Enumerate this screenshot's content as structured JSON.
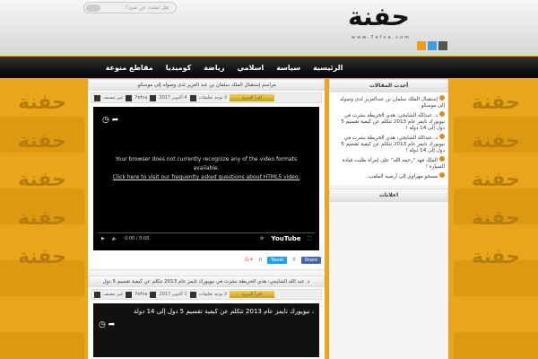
{
  "header": {
    "search_placeholder": "هل تبحث عن شئ؟",
    "logo_text": "حفنة",
    "logo_url": "www.7efna.com"
  },
  "socials": [
    {
      "name": "rss",
      "color": "#f39c12"
    },
    {
      "name": "twitter",
      "color": "#3aa0e8"
    },
    {
      "name": "user",
      "color": "#555555"
    }
  ],
  "nav": [
    "الرئيسية",
    "سياسة",
    "اسلامي",
    "رياضة",
    "كوميديا",
    "مقاطع منوعة"
  ],
  "posts": [
    {
      "title": "مراسم إستقبال الملك سلمان بن عبد العزيز لدى وصوله إلى موسكو.",
      "category": "غير مصنف",
      "author": "7efna",
      "date": "4 أكتوبر 2017",
      "comments": "لا توجد تعليقات",
      "read_more": "اقرأ المزيد",
      "video": {
        "message": "Your browser does not currently recognize any of the video formats available.",
        "link": "Click here to visit our frequently asked questions about HTML5 video.",
        "time": "0:00 / 0:00",
        "brand": "YouTube"
      },
      "share": {
        "facebook": "Share",
        "facebook_count": "0",
        "twitter": "Tweet",
        "twitter_count": "0",
        "gplus": "G+"
      }
    },
    {
      "title": "د. عبد الله الشايجي: هذي الخريطة نشرت في نيويورك تايمز عام 2013 تتكلم عن كيفية تقسيم 5 دول",
      "category": "غير مصنف",
      "author": "7efna",
      "date": "1 أكتوبر 2017",
      "comments": "لا توجد تعليقات",
      "read_more": "اقرأ المزيد",
      "video_title": "، نيويورك تايمز عام 2013 تتكلم عن كيفية تقسيم 5 دول إلى 14 دولة"
    }
  ],
  "sidebar": {
    "recent_title": "أحدث المقالات",
    "recent": [
      "إستقبال الملك سلمان بن عبدالعزيز لدى وصوله إلى موسكو .",
      "د. عبدالله الشايجي: هذي الخريطة نشرت في نيويورك تايمز عام 2013 تتكلم عن كيفية تقسيم 5 دول إلى 14 دولة !",
      "د. عبدالله الشايجي: هذي الخريطة نشرت في نيويورك تايمز عام 2013 تتكلم عن كيفية تقسيم 5 دول إلى 14 دولة !",
      "الملك فهد \"رحمه الله\" على إمرأة طلبت قيادة السيارة !",
      "مسجو مهراوي إلى أرضيه الملعب ."
    ],
    "ads_title": "اعلانات"
  }
}
